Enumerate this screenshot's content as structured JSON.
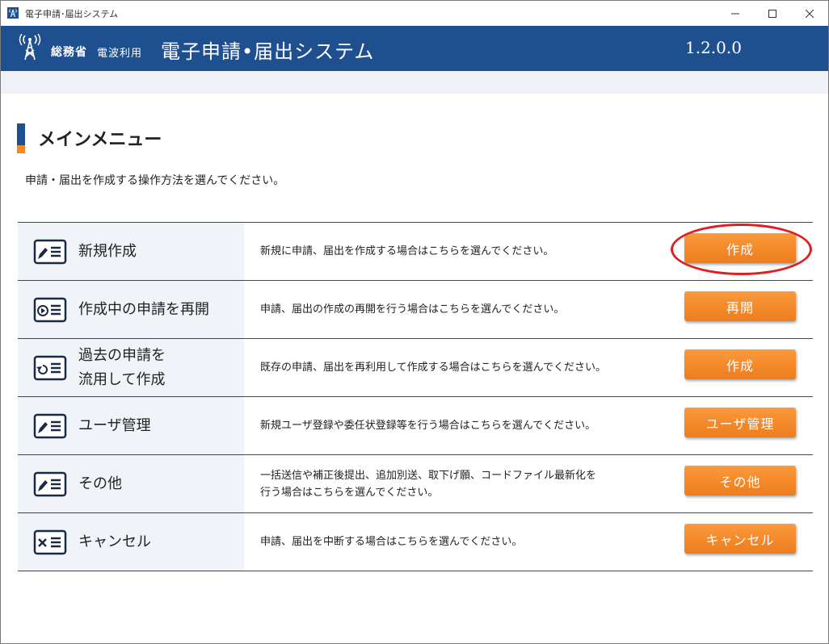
{
  "window": {
    "title": "電子申請･届出システム"
  },
  "header": {
    "ministry": "総務省",
    "usage": "電波利用",
    "system_title": "電子申請•届出システム",
    "version": "1.2.0.0"
  },
  "section": {
    "title": "メインメニュー",
    "description": "申請・届出を作成する操作方法を選んでください。"
  },
  "menu": [
    {
      "label": "新規作成",
      "description": "新規に申請、届出を作成する場合はこちらを選んでください。",
      "button": "作成",
      "icon": "document-pen-icon"
    },
    {
      "label": "作成中の申請を再開",
      "description": "申請、届出の作成の再開を行う場合はこちらを選んでください。",
      "button": "再開",
      "icon": "document-play-icon"
    },
    {
      "label": "過去の申請を\n流用して作成",
      "description": "既存の申請、届出を再利用して作成する場合はこちらを選んでください。",
      "button": "作成",
      "icon": "document-reuse-icon"
    },
    {
      "label": "ユーザ管理",
      "description": "新規ユーザ登録や委任状登録等を行う場合はこちらを選んでください。",
      "button": "ユーザ管理",
      "icon": "document-pen-icon"
    },
    {
      "label": "その他",
      "description": "一括送信や補正後提出、追加別送、取下げ願、コードファイル最新化を\n行う場合はこちらを選んでください。",
      "button": "その他",
      "icon": "document-pen-icon"
    },
    {
      "label": "キャンセル",
      "description": "申請、届出を中断する場合はこちらを選んでください。",
      "button": "キャンセル",
      "icon": "document-cancel-icon"
    }
  ],
  "colors": {
    "header": "#1e4f8e",
    "accent": "#f18b2a",
    "button": "#ee7c1c",
    "highlight_ring": "#e02020"
  }
}
